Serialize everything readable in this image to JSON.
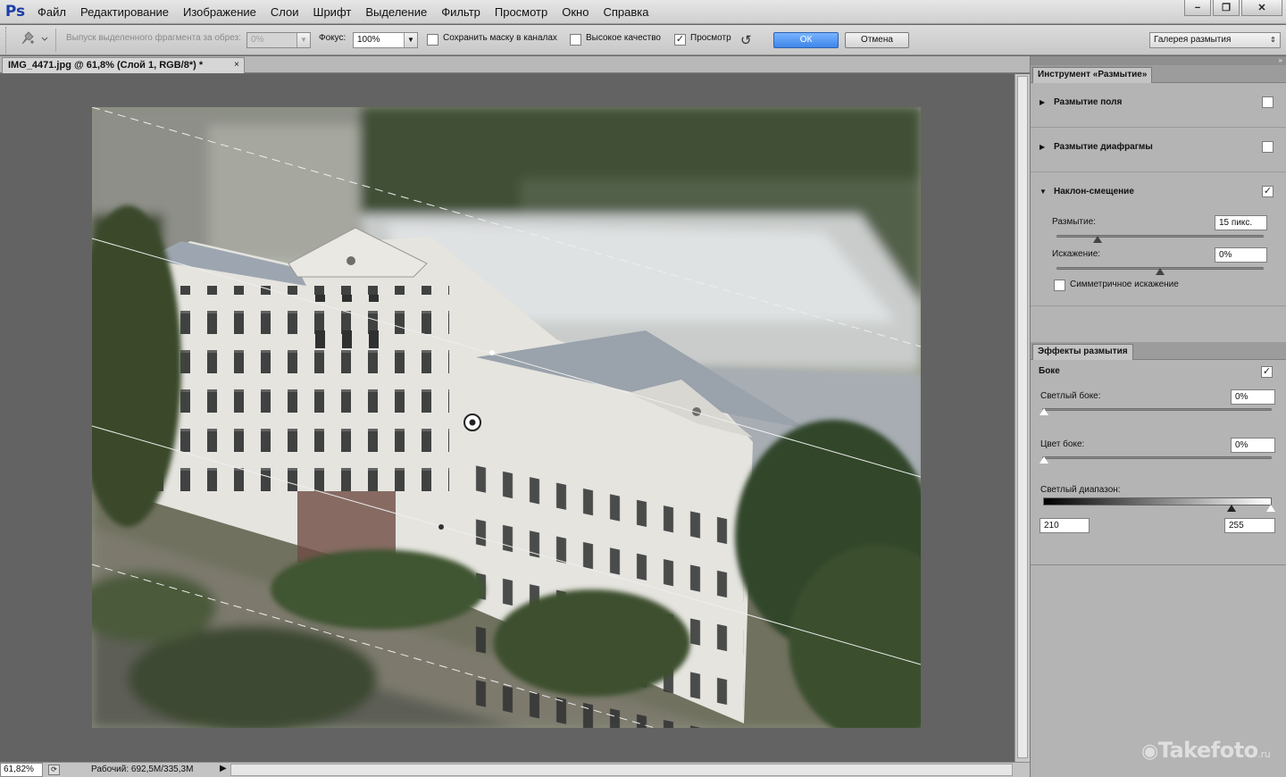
{
  "app": {
    "logo": "Ps"
  },
  "menu": [
    "Файл",
    "Редактирование",
    "Изображение",
    "Слои",
    "Шрифт",
    "Выделение",
    "Фильтр",
    "Просмотр",
    "Окно",
    "Справка"
  ],
  "window_controls": {
    "minimize": "−",
    "restore": "❐",
    "close": "✕"
  },
  "options": {
    "selection_output_label": "Выпуск выделенного фрагмента за обрез:",
    "selection_output_value": "0%",
    "focus_label": "Фокус:",
    "focus_value": "100%",
    "save_mask_label": "Сохранить маску в каналах",
    "save_mask_checked": false,
    "high_quality_label": "Высокое качество",
    "high_quality_checked": false,
    "preview_label": "Просмотр",
    "preview_checked": true,
    "ok_label": "ОК",
    "cancel_label": "Отмена",
    "workspace_value": "Галерея размытия"
  },
  "document": {
    "tab_title": "IMG_4471.jpg @ 61,8% (Слой 1, RGB/8*) *",
    "close_glyph": "×"
  },
  "status": {
    "zoom": "61,82%",
    "info": "Рабочий: 692,5M/335,3M",
    "arrow": "▶"
  },
  "blur_tools_panel": {
    "tab": "Инструмент «Размытие»",
    "tools": [
      {
        "label": "Размытие поля",
        "expanded": false,
        "checked": false
      },
      {
        "label": "Размытие диафрагмы",
        "expanded": false,
        "checked": false
      },
      {
        "label": "Наклон-смещение",
        "expanded": true,
        "checked": true
      }
    ],
    "blur_label": "Размытие:",
    "blur_value": "15 пикс.",
    "blur_level": 0.2,
    "distortion_label": "Искажение:",
    "distortion_value": "0%",
    "distortion_level": 0.5,
    "symmetric_label": "Симметричное искажение",
    "symmetric_checked": false
  },
  "blur_effects_panel": {
    "tab": "Эффекты размытия",
    "bokeh_label": "Боке",
    "bokeh_checked": true,
    "light_bokeh_label": "Светлый боке:",
    "light_bokeh_value": "0%",
    "bokeh_color_label": "Цвет боке:",
    "bokeh_color_value": "0%",
    "light_range_label": "Светлый диапазон:",
    "light_range_min": "210",
    "light_range_max": "255"
  },
  "watermark": {
    "brand": "Takefoto",
    "tld": ".ru"
  },
  "colors": {
    "accent": "#3e86e8",
    "ps_blue": "#1c3fa8"
  }
}
